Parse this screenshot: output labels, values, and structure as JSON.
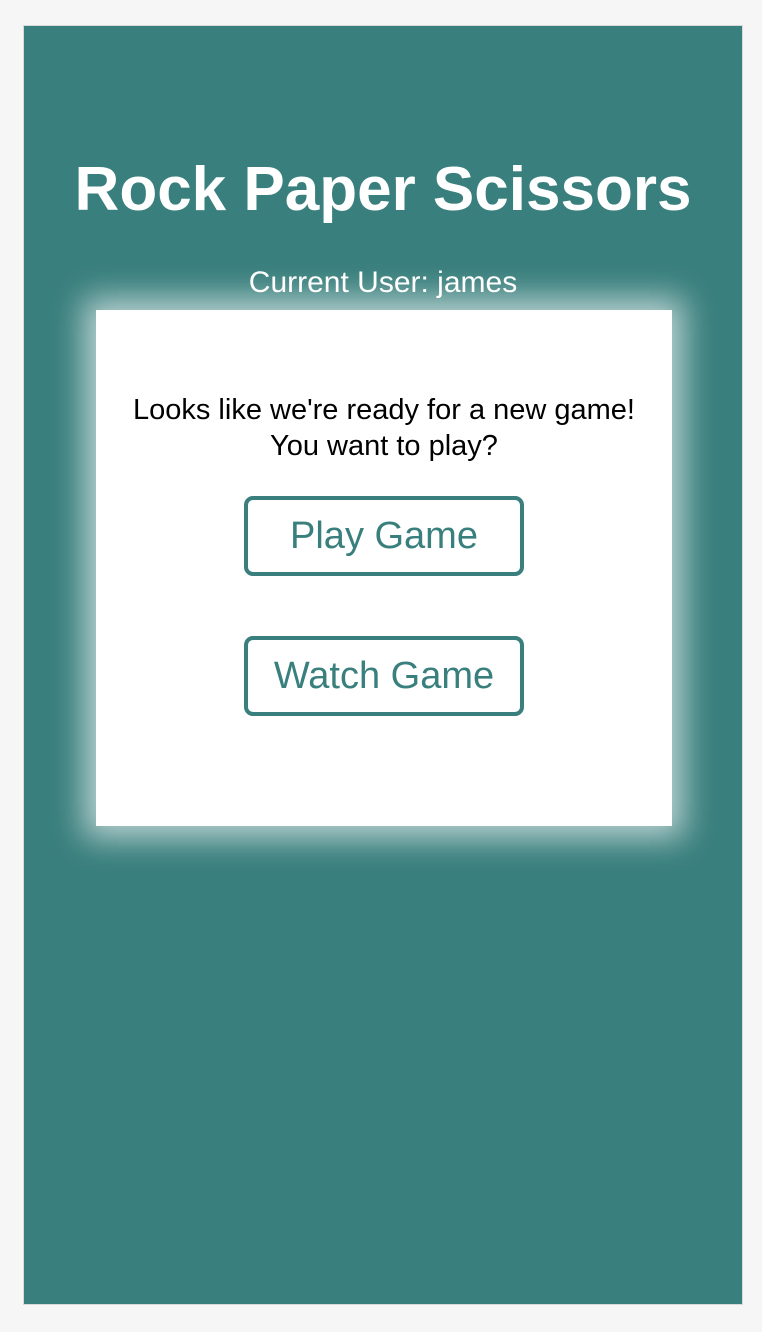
{
  "app": {
    "title": "Rock Paper Scissors",
    "current_user_label": "Current User: james"
  },
  "card": {
    "message_line1": "Looks like we're ready for a new game!",
    "message_line2": "You want to play?",
    "play_button_label": "Play Game",
    "watch_button_label": "Watch Game"
  },
  "colors": {
    "background": "#397f7d",
    "card": "#ffffff",
    "button_text": "#397f7d",
    "title_text": "#ffffff"
  }
}
